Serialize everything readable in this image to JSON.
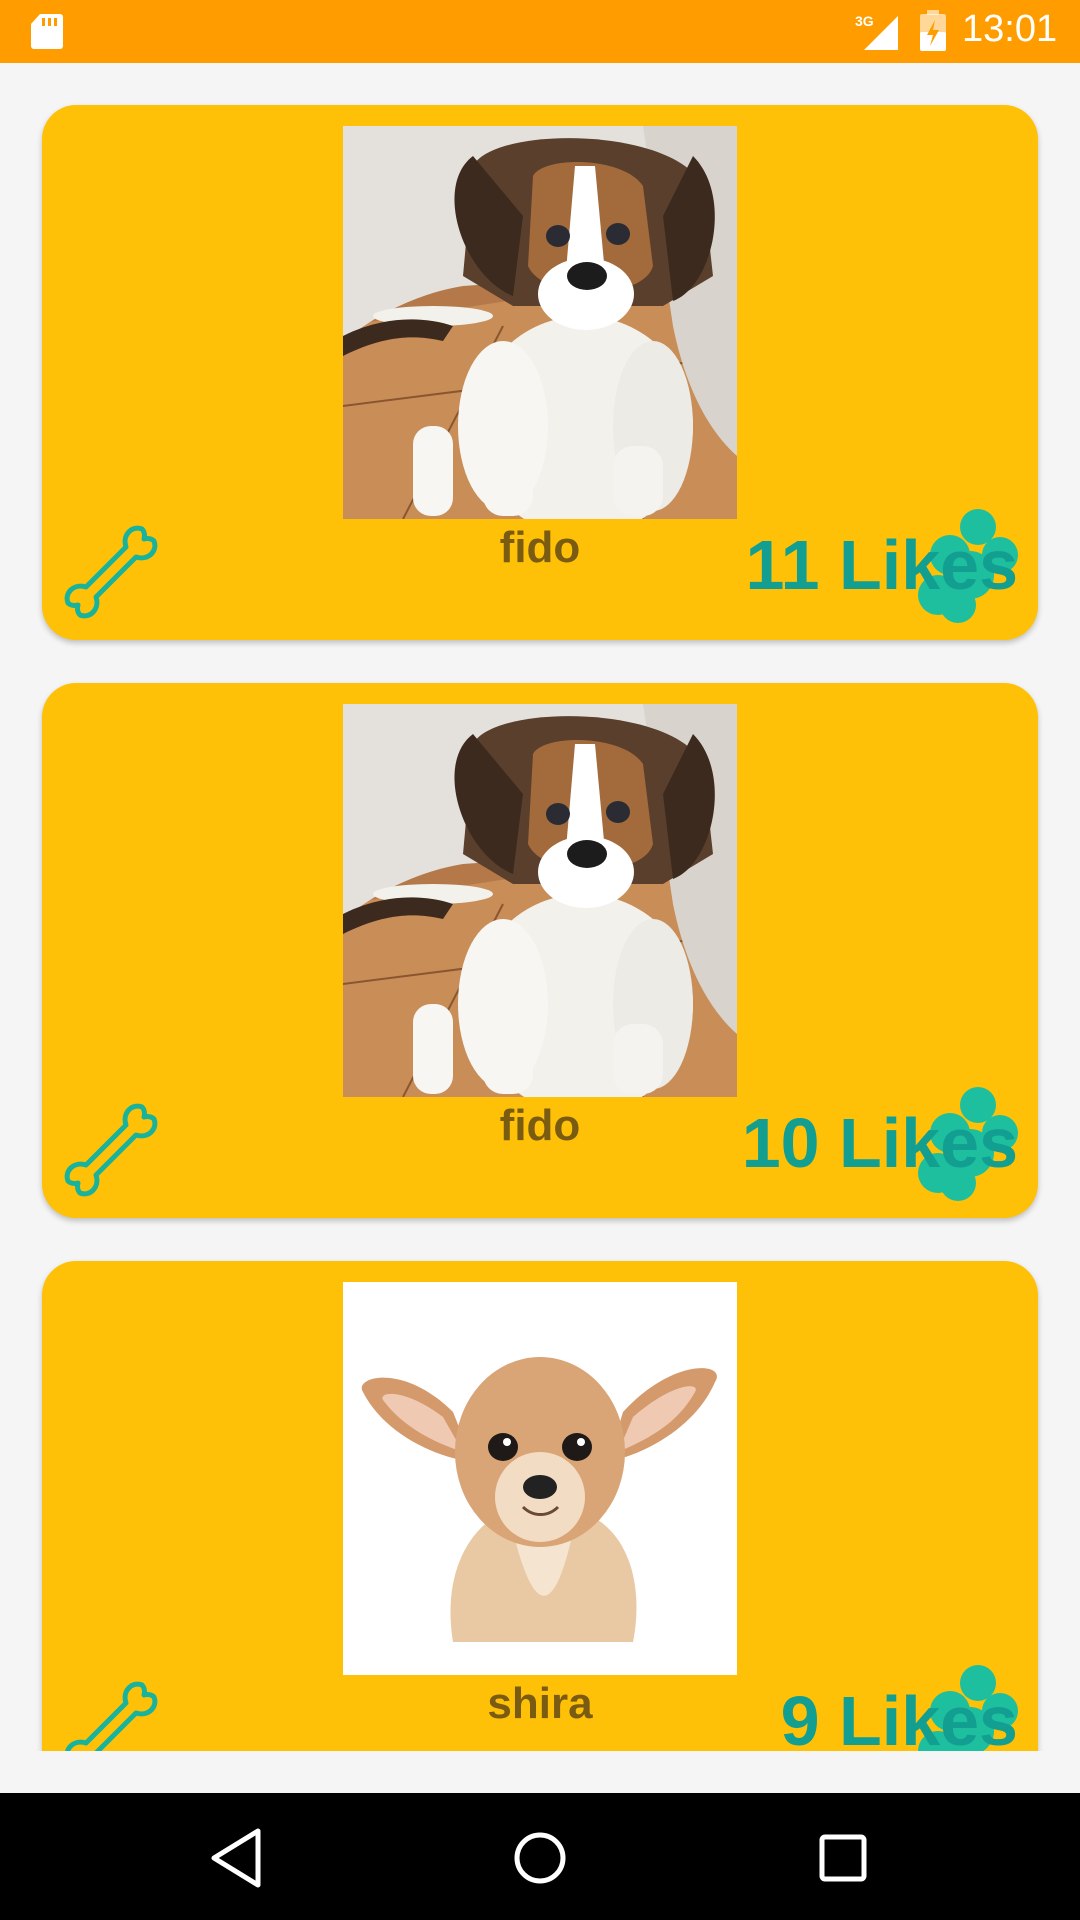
{
  "status_bar": {
    "time": "13:01",
    "network": "3G",
    "icons": [
      "sd-card-icon",
      "cell-signal-icon",
      "battery-charging-icon"
    ],
    "background": "#ff9d00"
  },
  "theme": {
    "card_color": "#ffc107",
    "name_color": "#7a5b12",
    "likes_color": "#129e91"
  },
  "posts": [
    {
      "name": "fido",
      "likes": "11 Likes",
      "photo": "beagle puppy"
    },
    {
      "name": "fido",
      "likes": "10 Likes",
      "photo": "beagle puppy"
    },
    {
      "name": "shira",
      "likes": "9 Likes",
      "photo": "chihuahua"
    }
  ],
  "nav_bar": {
    "buttons": [
      "back-icon",
      "home-icon",
      "recents-icon"
    ]
  }
}
